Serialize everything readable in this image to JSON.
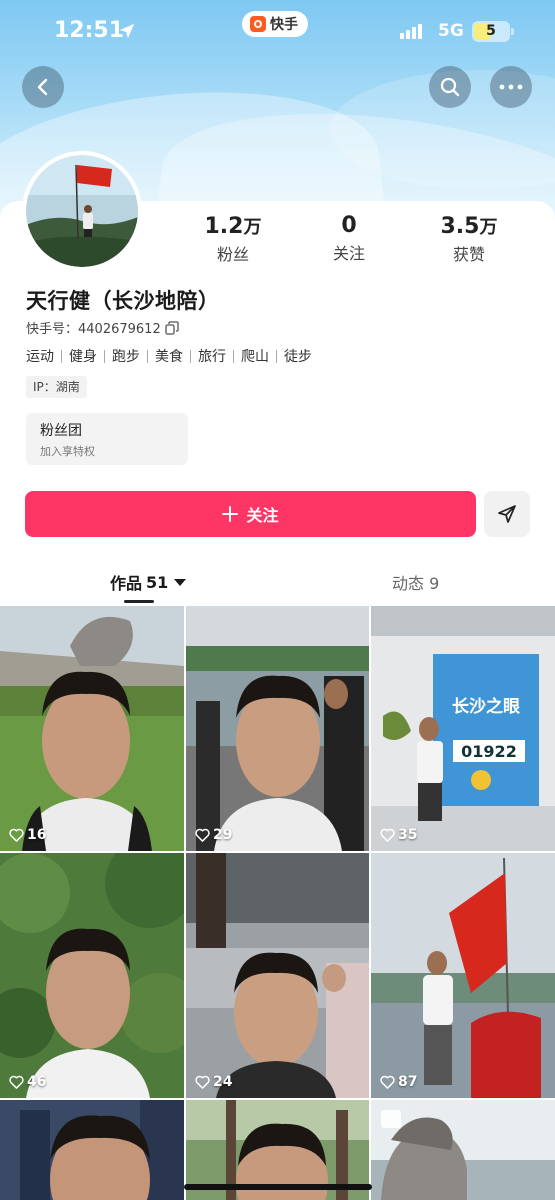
{
  "status_bar": {
    "time": "12:51",
    "network": "5G",
    "battery": "5",
    "battery_level": 0.5,
    "app_badge": "快手"
  },
  "profile": {
    "name": "天行健（长沙地陪）",
    "uid": "快手号：4402679612",
    "tags": [
      "运动",
      "健身",
      "跑步",
      "美食",
      "旅行",
      "爬山",
      "徒步"
    ],
    "ip": "IP：湖南"
  },
  "stats": [
    {
      "value": "1.2",
      "unit": "万",
      "label": "粉丝"
    },
    {
      "value": "0",
      "unit": "",
      "label": "关注"
    },
    {
      "value": "3.5",
      "unit": "万",
      "label": "获赞"
    }
  ],
  "fan_club": {
    "title": "粉丝团",
    "subtitle": "加入享特权"
  },
  "actions": {
    "follow_label": "关注"
  },
  "tabs": {
    "works_label": "作品",
    "works_count": "51",
    "moments_label": "动态 9"
  },
  "videos": [
    {
      "likes": "16",
      "scene": "statue-lawn"
    },
    {
      "likes": "29",
      "scene": "riverside"
    },
    {
      "likes": "35",
      "scene": "changsha-eye-sign"
    },
    {
      "likes": "46",
      "scene": "forest"
    },
    {
      "likes": "24",
      "scene": "building"
    },
    {
      "likes": "87",
      "scene": "red-flag"
    },
    {
      "likes": "",
      "scene": "city-night"
    },
    {
      "likes": "",
      "scene": "park"
    },
    {
      "likes": "",
      "scene": "statue-closeup"
    }
  ],
  "sign_text": {
    "title": "长沙之眼",
    "counter": "01922"
  },
  "colors": {
    "accent": "#fe3666",
    "sky": "#8fd0f4"
  }
}
